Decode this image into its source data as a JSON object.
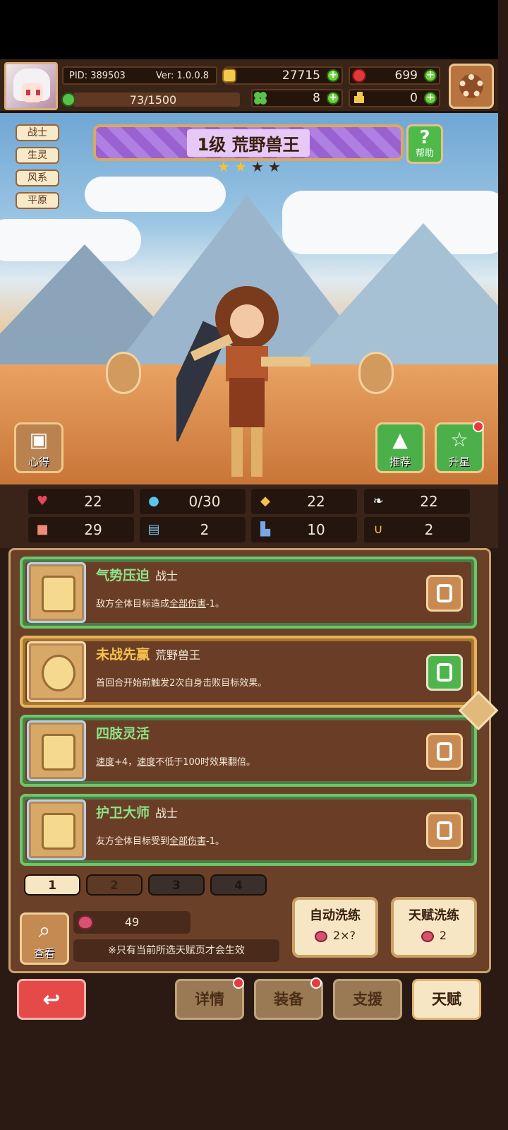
{
  "header": {
    "pid_label": "PID: 389503",
    "version_label": "Ver: 1.0.0.8",
    "exp_text": "73/1500",
    "gold": "27715",
    "gems": "699",
    "clover": "8",
    "keys": "0"
  },
  "tags": [
    "战士",
    "生灵",
    "风系",
    "平原"
  ],
  "hero": {
    "title": "1级  荒野兽王",
    "stars_filled": 2,
    "stars_total": 4,
    "help_label": "帮助"
  },
  "scene_buttons": {
    "insight_label": "心得",
    "recommend_label": "推荐",
    "upgrade_star_label": "升星"
  },
  "stats": [
    {
      "icon": "heart-icon",
      "value": "22"
    },
    {
      "icon": "mana-drop-icon",
      "value": "0/30"
    },
    {
      "icon": "shield-icon",
      "value": "22"
    },
    {
      "icon": "wing-icon",
      "value": "22"
    },
    {
      "icon": "fist-icon",
      "value": "29"
    },
    {
      "icon": "book-icon",
      "value": "2"
    },
    {
      "icon": "boot-icon",
      "value": "10"
    },
    {
      "icon": "horseshoe-icon",
      "value": "2"
    }
  ],
  "talents": [
    {
      "name": "气势压迫",
      "sub": "战士",
      "desc_pre": "敌方全体目标造成",
      "desc_u": "全部伤害",
      "desc_post": "-1。",
      "style": "green",
      "lock": "locked"
    },
    {
      "name": "未战先赢",
      "sub": "荒野兽王",
      "desc_pre": "首回合开始前触发2次自身击败目标效果。",
      "desc_u": "",
      "desc_post": "",
      "style": "gold",
      "lock": "green"
    },
    {
      "name": "四肢灵活",
      "sub": "",
      "desc_pre": "",
      "desc_u": "速度",
      "desc_post": "+4，",
      "desc_u2": "速度",
      "desc_post2": "不低于100时效果翻倍。",
      "style": "green",
      "lock": "locked"
    },
    {
      "name": "护卫大师",
      "sub": "战士",
      "desc_pre": "友方全体目标受到",
      "desc_u": "全部伤害",
      "desc_post": "-1。",
      "style": "green",
      "lock": "locked"
    }
  ],
  "pages": [
    "1",
    "2",
    "3",
    "4"
  ],
  "bottom": {
    "view_label": "查看",
    "fruit_count": "49",
    "hint": "※只有当前所选天赋页才会生效",
    "auto_wash_label": "自动洗练",
    "auto_wash_cost": "2×?",
    "talent_wash_label": "天赋洗练",
    "talent_wash_cost": "2"
  },
  "nav": {
    "details": "详情",
    "equipment": "装备",
    "support": "支援",
    "talent": "天赋"
  },
  "colors": {
    "green_frame": "#6cc66a",
    "gold_frame": "#e4b35b",
    "panel": "#6b4028",
    "back_red": "#e64a48"
  }
}
